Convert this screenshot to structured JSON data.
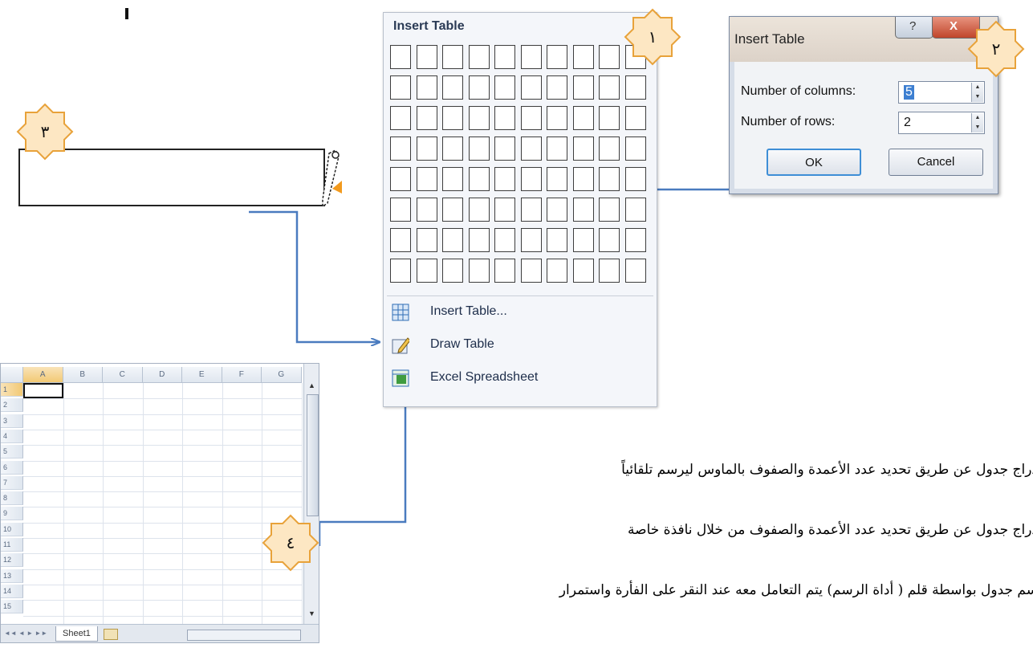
{
  "insert_table_menu": {
    "title": "Insert Table",
    "items": [
      {
        "label": "Insert Table...",
        "icon": "table-grid-icon"
      },
      {
        "label": "Draw Table",
        "icon": "pencil-table-icon"
      },
      {
        "label": "Excel Spreadsheet",
        "icon": "excel-sheet-icon"
      }
    ]
  },
  "insert_table_dialog": {
    "title": "Insert Table",
    "help_glyph": "?",
    "close_glyph": "X",
    "columns_label": "Number of columns:",
    "columns_value": "5",
    "rows_label": "Number of rows:",
    "rows_value": "2",
    "ok_label": "OK",
    "cancel_label": "Cancel"
  },
  "badges": {
    "one": "١",
    "two": "٢",
    "three": "٣",
    "four": "٤"
  },
  "excel": {
    "columns": [
      "A",
      "B",
      "C",
      "D",
      "E",
      "F",
      "G"
    ],
    "rows": [
      "1",
      "2",
      "3",
      "4",
      "5",
      "6",
      "7",
      "8",
      "9",
      "10",
      "11",
      "12",
      "13",
      "14",
      "15"
    ],
    "sheet_tab": "Sheet1"
  },
  "text_lines": [
    "دراج جدول عن طريق تحديد عدد الأعمدة والصفوف بالماوس ليرسم تلقائياً",
    "دراج جدول عن طريق تحديد عدد الأعمدة والصفوف من خلال نافذة خاصة",
    "سم جدول بواسطة قلم ( أداة الرسم) يتم التعامل معه عند النقر على الفأرة واستمرار"
  ],
  "colors": {
    "arrow": "#4a7bbf",
    "star_fill": "#fde7c3",
    "star_stroke": "#e8a23a"
  }
}
